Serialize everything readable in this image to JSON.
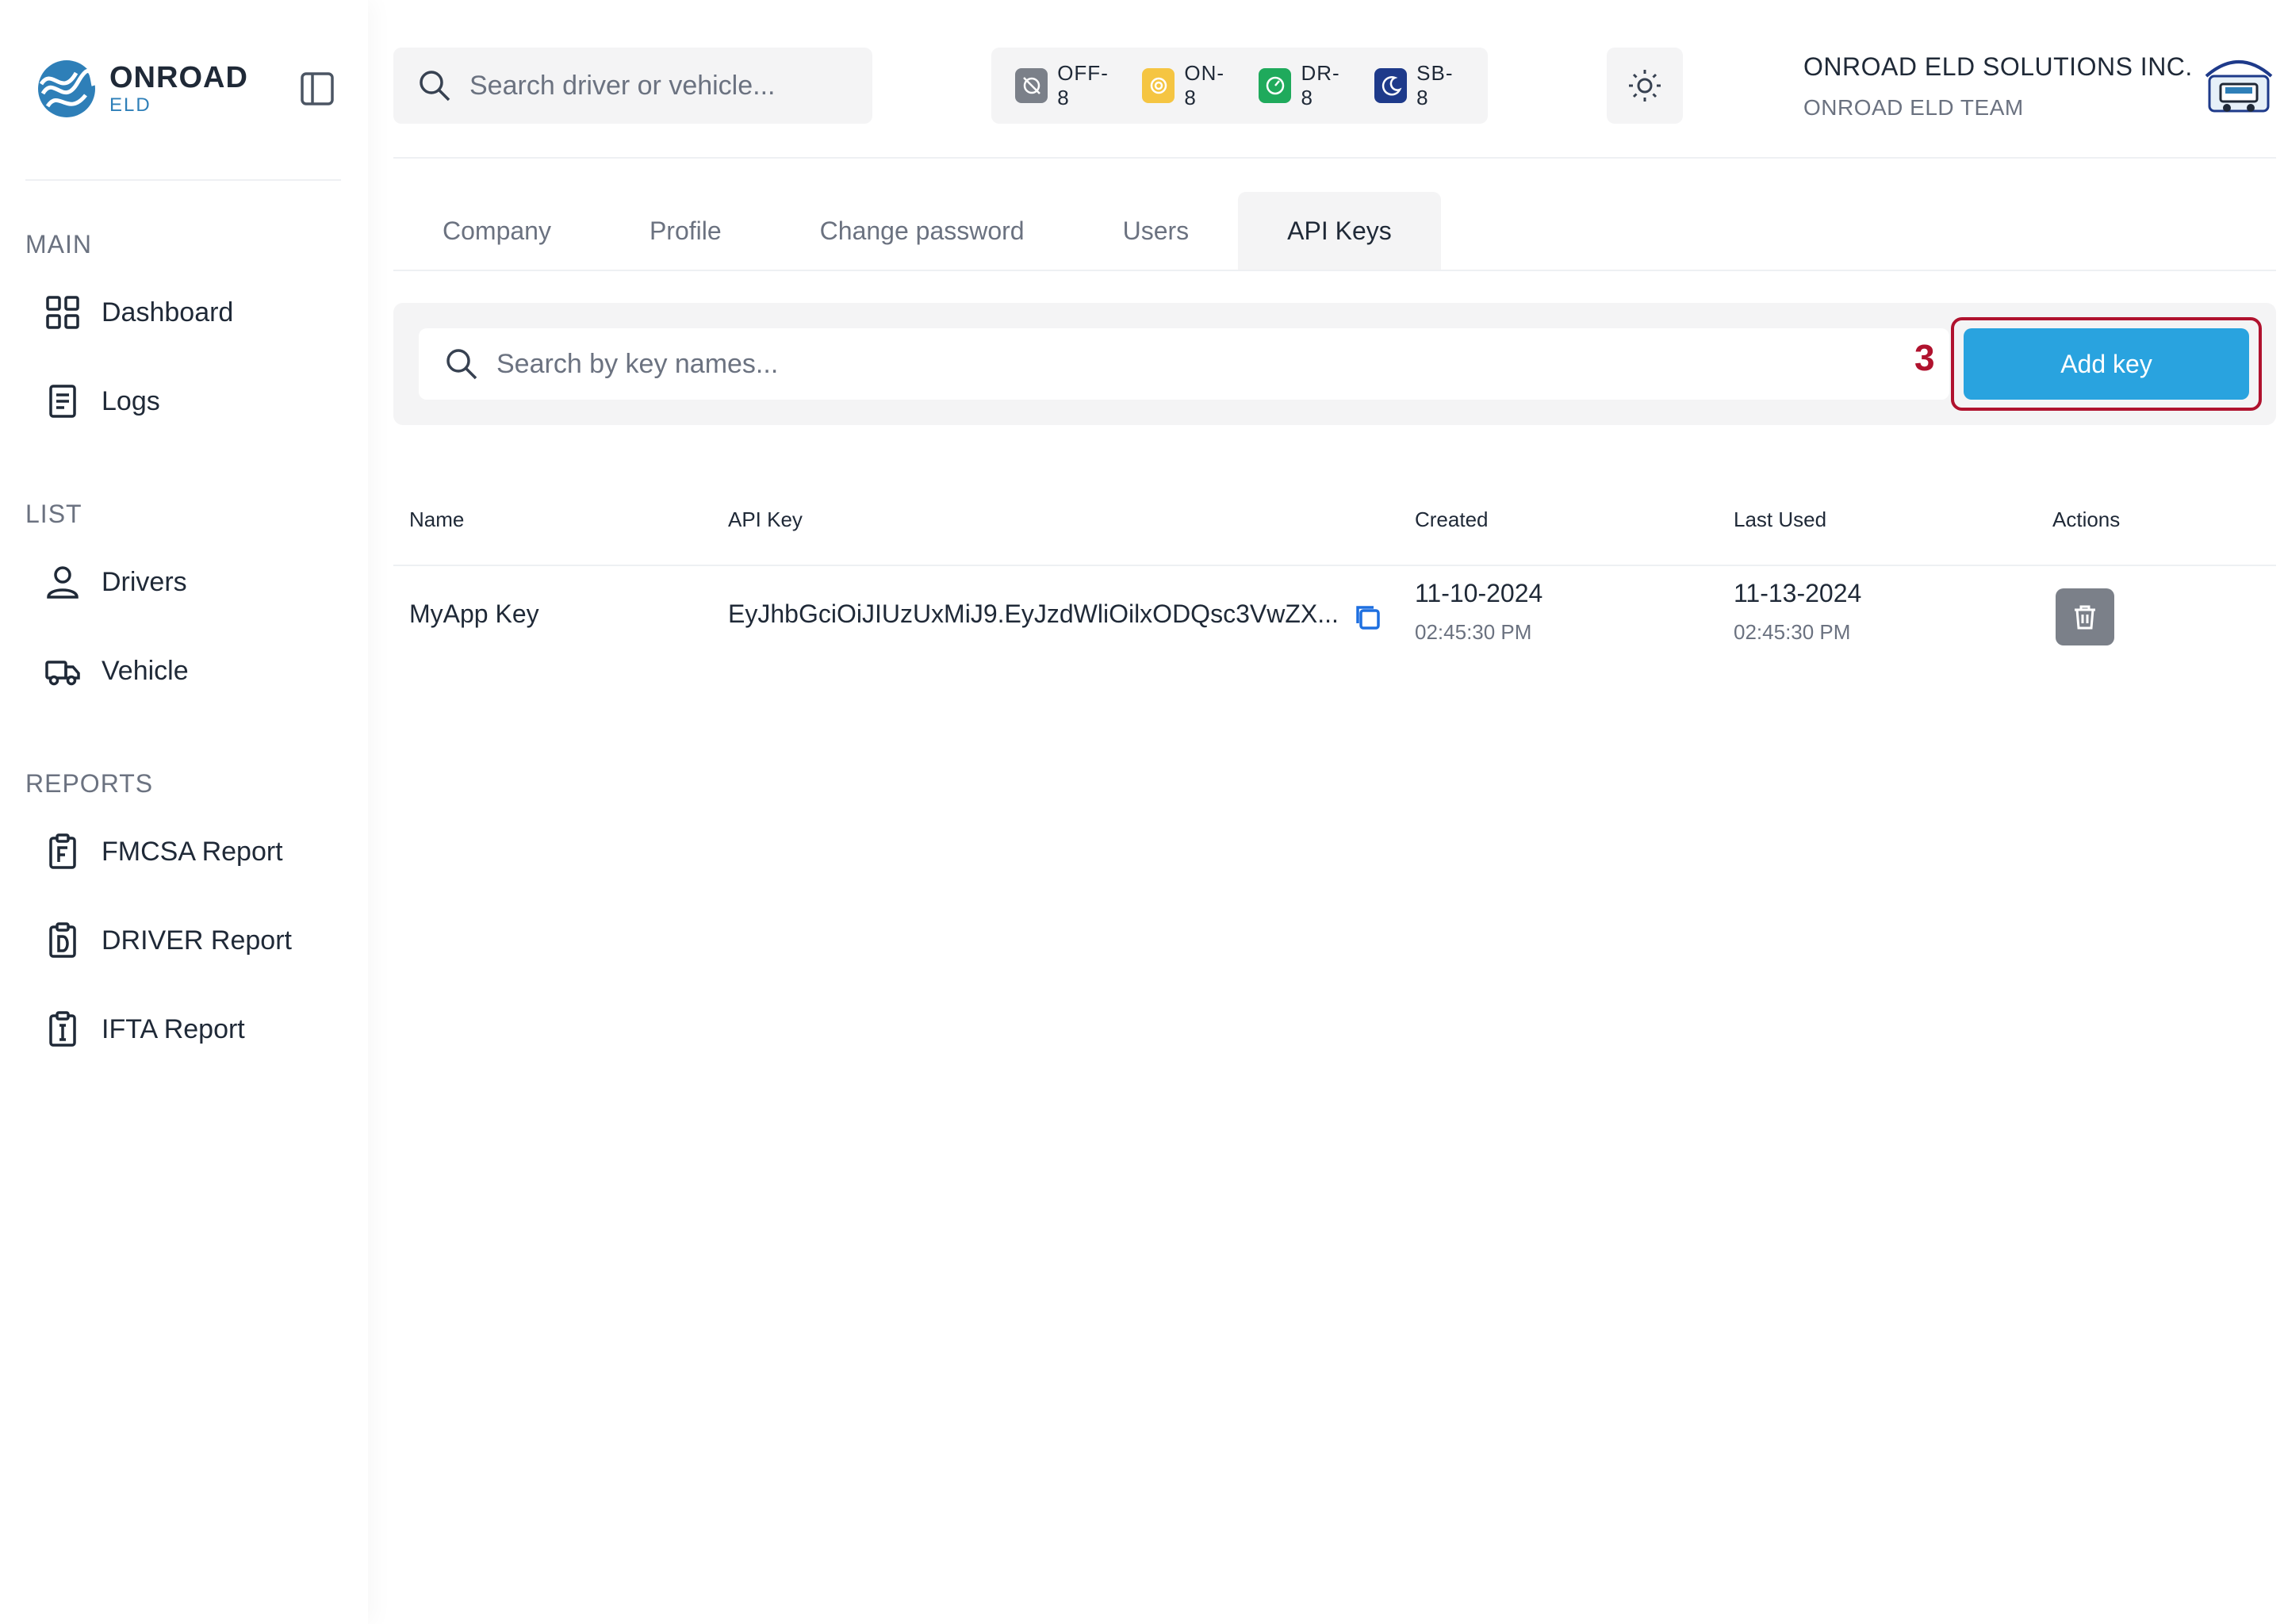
{
  "brand": {
    "name": "ONROAD",
    "sub": "ELD"
  },
  "sidebar": {
    "sections": [
      {
        "label": "MAIN",
        "items": [
          {
            "label": "Dashboard",
            "icon": "grid-icon"
          },
          {
            "label": "Logs",
            "icon": "document-icon"
          }
        ]
      },
      {
        "label": "LIST",
        "items": [
          {
            "label": "Drivers",
            "icon": "user-icon"
          },
          {
            "label": "Vehicle",
            "icon": "truck-icon"
          }
        ]
      },
      {
        "label": "REPORTS",
        "items": [
          {
            "label": "FMCSA Report",
            "icon": "clipboard-f-icon"
          },
          {
            "label": "DRIVER Report",
            "icon": "clipboard-d-icon"
          },
          {
            "label": "IFTA Report",
            "icon": "clipboard-i-icon"
          }
        ]
      }
    ]
  },
  "header": {
    "search_placeholder": "Search driver or vehicle...",
    "statuses": [
      {
        "label": "OFF-8",
        "color": "#7b8089"
      },
      {
        "label": "ON-8",
        "color": "#f5c542"
      },
      {
        "label": "DR-8",
        "color": "#1faa5c"
      },
      {
        "label": "SB-8",
        "color": "#1e3a8a"
      }
    ],
    "company_name": "ONROAD ELD SOLUTIONS INC.",
    "team_name": "ONROAD ELD TEAM"
  },
  "tabs": [
    {
      "label": "Company",
      "active": false
    },
    {
      "label": "Profile",
      "active": false
    },
    {
      "label": "Change password",
      "active": false
    },
    {
      "label": "Users",
      "active": false
    },
    {
      "label": "API Keys",
      "active": true
    }
  ],
  "toolbar": {
    "search_placeholder": "Search by key names...",
    "step_number": "3",
    "add_label": "Add key",
    "accent_color": "#29a3df",
    "highlight_color": "#b0122e"
  },
  "table": {
    "columns": [
      "Name",
      "API Key",
      "Created",
      "Last Used",
      "Actions"
    ],
    "rows": [
      {
        "name": "MyApp Key",
        "api_key": "EyJhbGciOiJIUzUxMiJ9.EyJzdWliOilxODQsc3VwZX...",
        "created_date": "11-10-2024",
        "created_time": "02:45:30 PM",
        "last_used_date": "11-13-2024",
        "last_used_time": "02:45:30 PM"
      }
    ]
  }
}
